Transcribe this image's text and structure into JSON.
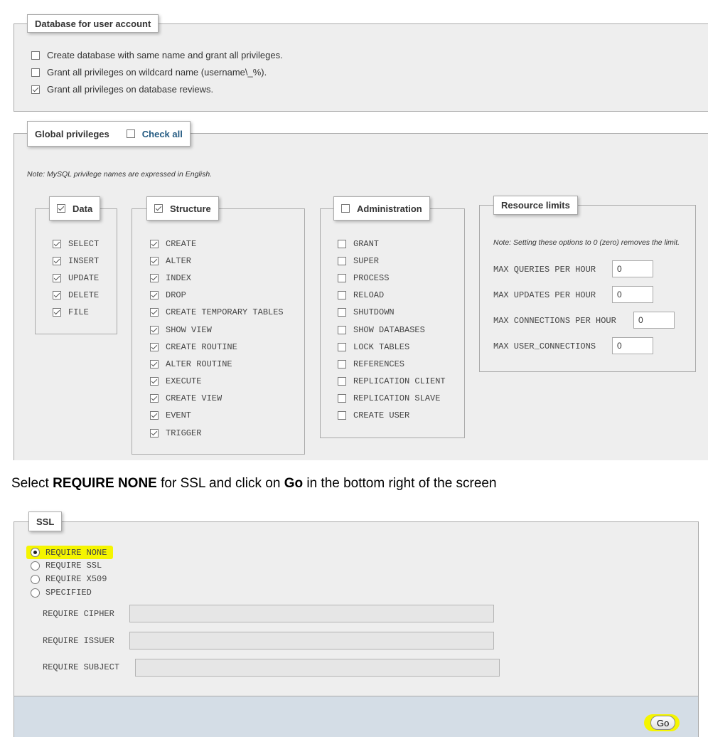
{
  "db_section": {
    "legend": "Database for user account",
    "options": [
      {
        "label": "Create database with same name and grant all privileges.",
        "checked": false
      },
      {
        "label": "Grant all privileges on wildcard name (username\\_%).",
        "checked": false
      },
      {
        "label": "Grant all privileges on database reviews.",
        "checked": true
      }
    ]
  },
  "global_privs": {
    "legend": "Global privileges",
    "check_all_label": "Check all",
    "note": "Note: MySQL privilege names are expressed in English.",
    "data": {
      "legend": "Data",
      "items": [
        "SELECT",
        "INSERT",
        "UPDATE",
        "DELETE",
        "FILE"
      ]
    },
    "structure": {
      "legend": "Structure",
      "items": [
        "CREATE",
        "ALTER",
        "INDEX",
        "DROP",
        "CREATE TEMPORARY TABLES",
        "SHOW VIEW",
        "CREATE ROUTINE",
        "ALTER ROUTINE",
        "EXECUTE",
        "CREATE VIEW",
        "EVENT",
        "TRIGGER"
      ]
    },
    "administration": {
      "legend": "Administration",
      "items": [
        "GRANT",
        "SUPER",
        "PROCESS",
        "RELOAD",
        "SHUTDOWN",
        "SHOW DATABASES",
        "LOCK TABLES",
        "REFERENCES",
        "REPLICATION CLIENT",
        "REPLICATION SLAVE",
        "CREATE USER"
      ]
    },
    "resource_limits": {
      "legend": "Resource limits",
      "note": "Note: Setting these options to 0 (zero) removes the limit.",
      "fields": [
        {
          "label": "MAX QUERIES PER HOUR",
          "value": "0"
        },
        {
          "label": "MAX UPDATES PER HOUR",
          "value": "0"
        },
        {
          "label": "MAX CONNECTIONS PER HOUR",
          "value": "0"
        },
        {
          "label": "MAX USER_CONNECTIONS",
          "value": "0"
        }
      ]
    }
  },
  "instruction": {
    "part1": "Select ",
    "bold1": "REQUIRE NONE",
    "part2": " for SSL and click on ",
    "bold2": "Go",
    "part3": " in the bottom right of the screen"
  },
  "ssl": {
    "legend": "SSL",
    "options": [
      {
        "label": "REQUIRE NONE",
        "selected": true
      },
      {
        "label": "REQUIRE SSL",
        "selected": false
      },
      {
        "label": "REQUIRE X509",
        "selected": false
      },
      {
        "label": "SPECIFIED",
        "selected": false
      }
    ],
    "fields": [
      {
        "label": "REQUIRE CIPHER",
        "value": ""
      },
      {
        "label": "REQUIRE ISSUER",
        "value": ""
      },
      {
        "label": "REQUIRE SUBJECT",
        "value": ""
      }
    ]
  },
  "footer": {
    "go_label": "Go",
    "bg_color": "#d4dde6"
  },
  "colors": {
    "highlight": "#f5f500",
    "link": "#235a81"
  }
}
